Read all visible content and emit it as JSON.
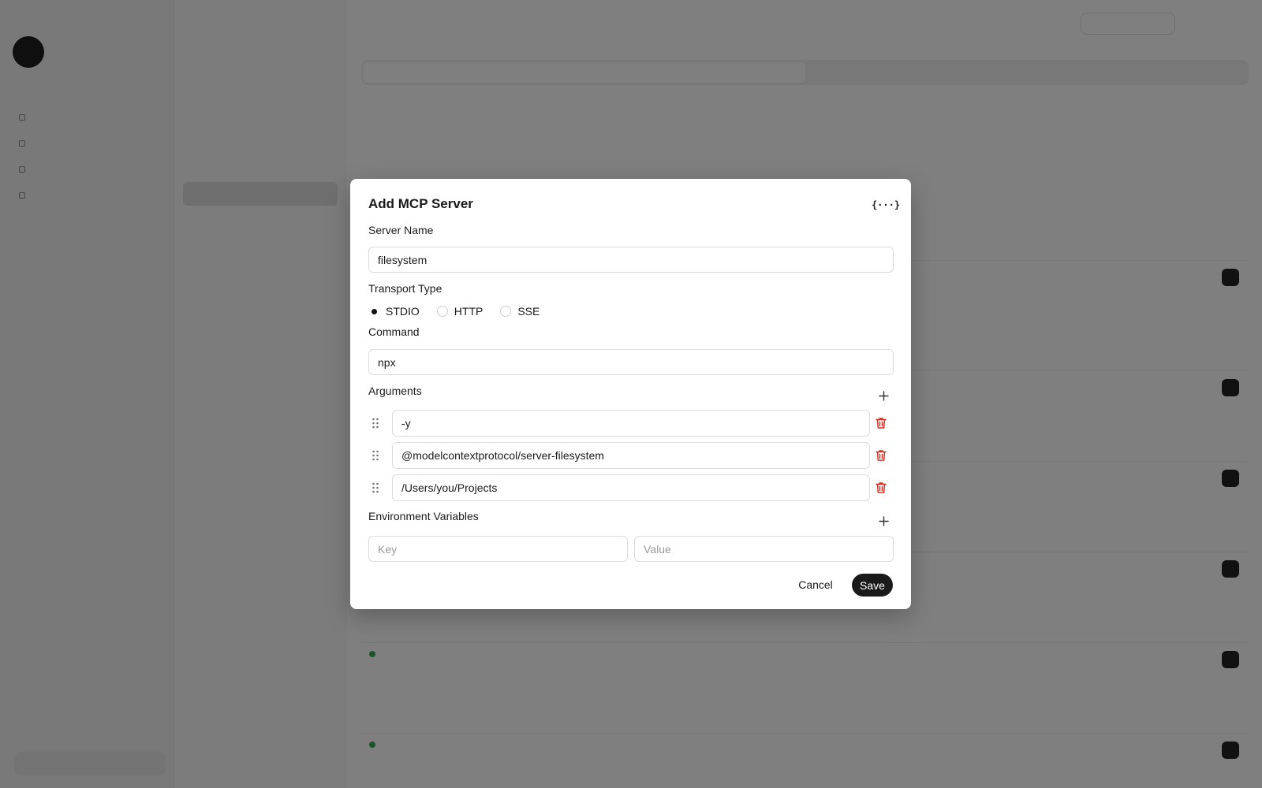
{
  "dialog": {
    "title": "Add MCP Server",
    "json_toggle_label": "{···}",
    "server_name": {
      "label": "Server Name",
      "value": "filesystem"
    },
    "transport": {
      "label": "Transport Type",
      "options": [
        "STDIO",
        "HTTP",
        "SSE"
      ],
      "selected": "STDIO"
    },
    "command": {
      "label": "Command",
      "value": "npx"
    },
    "arguments": {
      "label": "Arguments",
      "items": [
        "-y",
        "@modelcontextprotocol/server-filesystem",
        "/Users/you/Projects"
      ]
    },
    "env": {
      "label": "Environment Variables",
      "key_placeholder": "Key",
      "value_placeholder": "Value"
    },
    "cancel_label": "Cancel",
    "save_label": "Save"
  },
  "icons": {
    "json": "code-braces-icon",
    "add": "plus-icon",
    "drag": "drag-handle-icon",
    "delete": "trash-icon"
  },
  "colors": {
    "primary": "#1a1a1a",
    "danger": "#d93025",
    "overlay": "rgba(0,0,0,0.5)",
    "status_ok": "#3aa757"
  }
}
